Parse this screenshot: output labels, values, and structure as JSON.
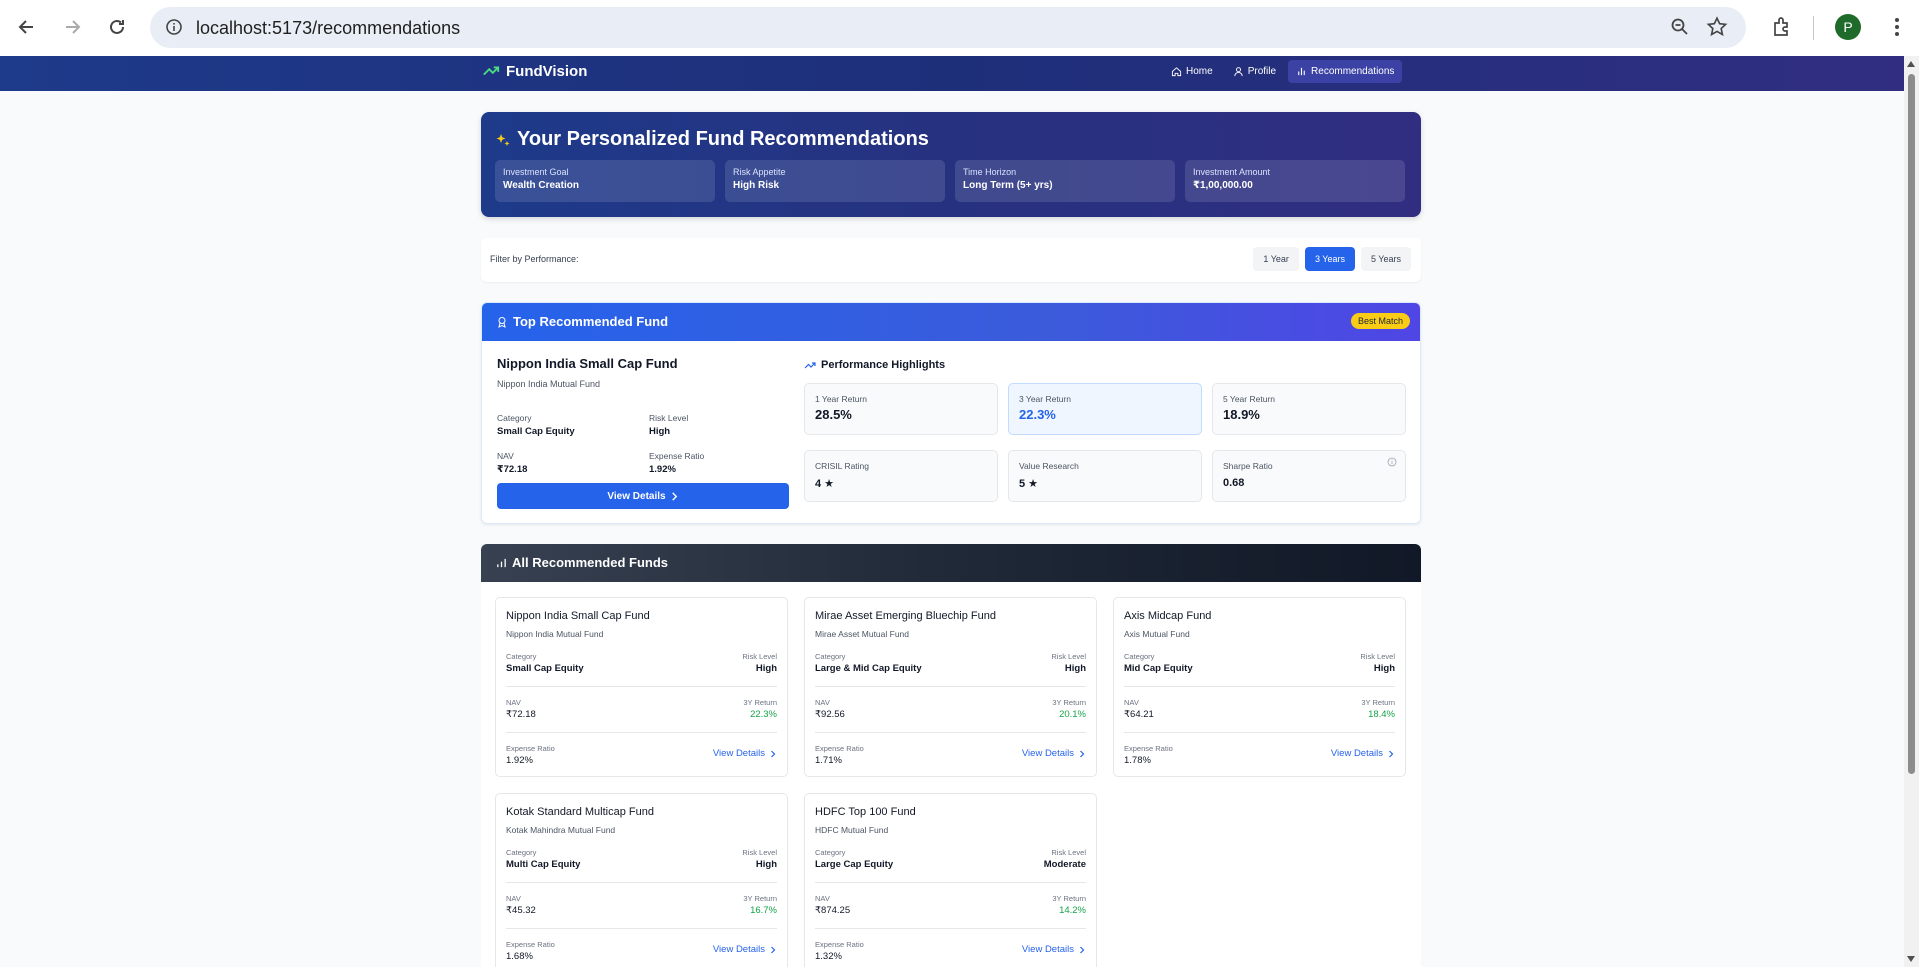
{
  "browser": {
    "url": "localhost:5173/recommendations",
    "avatar_letter": "P"
  },
  "header": {
    "brand": "FundVision",
    "nav": [
      {
        "label": "Home",
        "icon": "home-icon"
      },
      {
        "label": "Profile",
        "icon": "user-icon"
      },
      {
        "label": "Recommendations",
        "icon": "bar-chart-icon",
        "active": true
      }
    ]
  },
  "hero": {
    "title": "Your Personalized Fund Recommendations",
    "prefs": [
      {
        "label": "Investment Goal",
        "value": "Wealth Creation"
      },
      {
        "label": "Risk Appetite",
        "value": "High Risk"
      },
      {
        "label": "Time Horizon",
        "value": "Long Term (5+ yrs)"
      },
      {
        "label": "Investment Amount",
        "value": "₹1,00,000.00"
      }
    ]
  },
  "filter": {
    "label": "Filter by Performance:",
    "options": [
      "1 Year",
      "3 Years",
      "5 Years"
    ],
    "active": "3 Years"
  },
  "top_fund": {
    "section_title": "Top Recommended Fund",
    "badge": "Best Match",
    "name": "Nippon India Small Cap Fund",
    "house": "Nippon India Mutual Fund",
    "category_label": "Category",
    "category": "Small Cap Equity",
    "risk_label": "Risk Level",
    "risk": "High",
    "nav_label": "NAV",
    "nav": "₹72.18",
    "expense_label": "Expense Ratio",
    "expense": "1.92%",
    "view_label": "View Details",
    "perf_title": "Performance Highlights",
    "metrics": [
      {
        "label": "1 Year Return",
        "value": "28.5%"
      },
      {
        "label": "3 Year Return",
        "value": "22.3%"
      },
      {
        "label": "5 Year Return",
        "value": "18.9%"
      },
      {
        "label": "CRISIL Rating",
        "value": "4 ★"
      },
      {
        "label": "Value Research",
        "value": "5 ★"
      },
      {
        "label": "Sharpe Ratio",
        "value": "0.68"
      }
    ]
  },
  "all_funds": {
    "section_title": "All Recommended Funds",
    "labels": {
      "category": "Category",
      "risk": "Risk Level",
      "nav": "NAV",
      "return": "3Y Return",
      "expense": "Expense Ratio",
      "view": "View Details"
    },
    "funds": [
      {
        "name": "Nippon India Small Cap Fund",
        "house": "Nippon India Mutual Fund",
        "category": "Small Cap Equity",
        "risk": "High",
        "nav": "₹72.18",
        "ret": "22.3%",
        "expense": "1.92%"
      },
      {
        "name": "Mirae Asset Emerging Bluechip Fund",
        "house": "Mirae Asset Mutual Fund",
        "category": "Large & Mid Cap Equity",
        "risk": "High",
        "nav": "₹92.56",
        "ret": "20.1%",
        "expense": "1.71%"
      },
      {
        "name": "Axis Midcap Fund",
        "house": "Axis Mutual Fund",
        "category": "Mid Cap Equity",
        "risk": "High",
        "nav": "₹64.21",
        "ret": "18.4%",
        "expense": "1.78%"
      },
      {
        "name": "Kotak Standard Multicap Fund",
        "house": "Kotak Mahindra Mutual Fund",
        "category": "Multi Cap Equity",
        "risk": "High",
        "nav": "₹45.32",
        "ret": "16.7%",
        "expense": "1.68%"
      },
      {
        "name": "HDFC Top 100 Fund",
        "house": "HDFC Mutual Fund",
        "category": "Large Cap Equity",
        "risk": "Moderate",
        "nav": "₹874.25",
        "ret": "14.2%",
        "expense": "1.32%"
      }
    ]
  }
}
